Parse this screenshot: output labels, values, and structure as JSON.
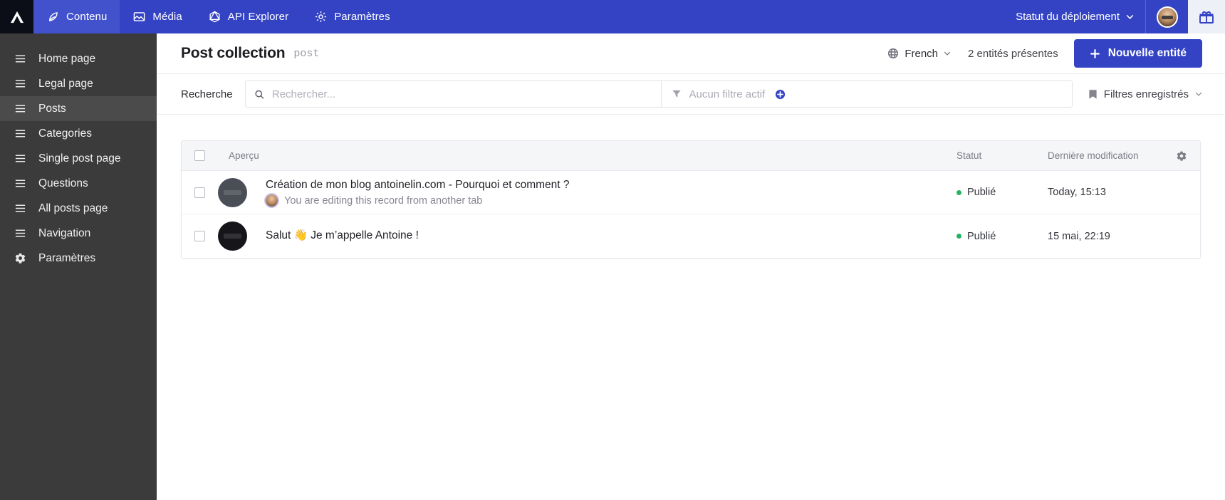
{
  "topbar": {
    "logo_icon": "aleph-logo-icon",
    "nav": [
      {
        "label": "Contenu",
        "icon": "feather-icon",
        "active": true
      },
      {
        "label": "Média",
        "icon": "image-icon",
        "active": false
      },
      {
        "label": "API Explorer",
        "icon": "graphql-icon",
        "active": false
      },
      {
        "label": "Paramètres",
        "icon": "gear-icon",
        "active": false
      }
    ],
    "deploy_status_label": "Statut du déploiement",
    "deploy_chevron_icon": "chevron-down-icon",
    "avatar_icon": "user-avatar",
    "gift_icon": "gift-icon"
  },
  "sidebar": {
    "items": [
      {
        "label": "Home page",
        "icon": "list-icon",
        "active": false
      },
      {
        "label": "Legal page",
        "icon": "list-icon",
        "active": false
      },
      {
        "label": "Posts",
        "icon": "list-icon",
        "active": true
      },
      {
        "label": "Categories",
        "icon": "list-icon",
        "active": false
      },
      {
        "label": "Single post page",
        "icon": "list-icon",
        "active": false
      },
      {
        "label": "Questions",
        "icon": "list-icon",
        "active": false
      },
      {
        "label": "All posts page",
        "icon": "list-icon",
        "active": false
      },
      {
        "label": "Navigation",
        "icon": "list-icon",
        "active": false
      },
      {
        "label": "Paramètres",
        "icon": "gear-icon",
        "active": false
      }
    ]
  },
  "page": {
    "title": "Post collection",
    "slug": "post",
    "language": "French",
    "language_icon": "globe-icon",
    "entity_count_label": "2 entités présentes",
    "new_entity_label": "Nouvelle entité",
    "plus_icon": "plus-icon"
  },
  "search": {
    "label": "Recherche",
    "placeholder": "Rechercher...",
    "value": "",
    "search_icon": "search-icon",
    "filter_icon": "funnel-icon",
    "filter_text": "Aucun filtre actif",
    "filter_add_icon": "plus-circle-icon",
    "saved_filters_label": "Filtres enregistrés",
    "saved_filters_icon": "bookmark-icon",
    "saved_filters_chevron": "chevron-down-icon"
  },
  "table": {
    "columns": {
      "preview": "Aperçu",
      "status": "Statut",
      "modified": "Dernière modification"
    },
    "settings_icon": "gear-icon",
    "rows": [
      {
        "title": "Création de mon blog antoinelin.com - Pourquoi et comment ?",
        "subtitle": "You are editing this record from another tab",
        "has_editing_notice": true,
        "status": "Publié",
        "status_color": "#27b161",
        "modified": "Today, 15:13",
        "thumb_style": "grey"
      },
      {
        "title": "Salut 👋 Je m’appelle Antoine !",
        "subtitle": "",
        "has_editing_notice": false,
        "status": "Publié",
        "status_color": "#27b161",
        "modified": "15 mai, 22:19",
        "thumb_style": "dark"
      }
    ]
  }
}
